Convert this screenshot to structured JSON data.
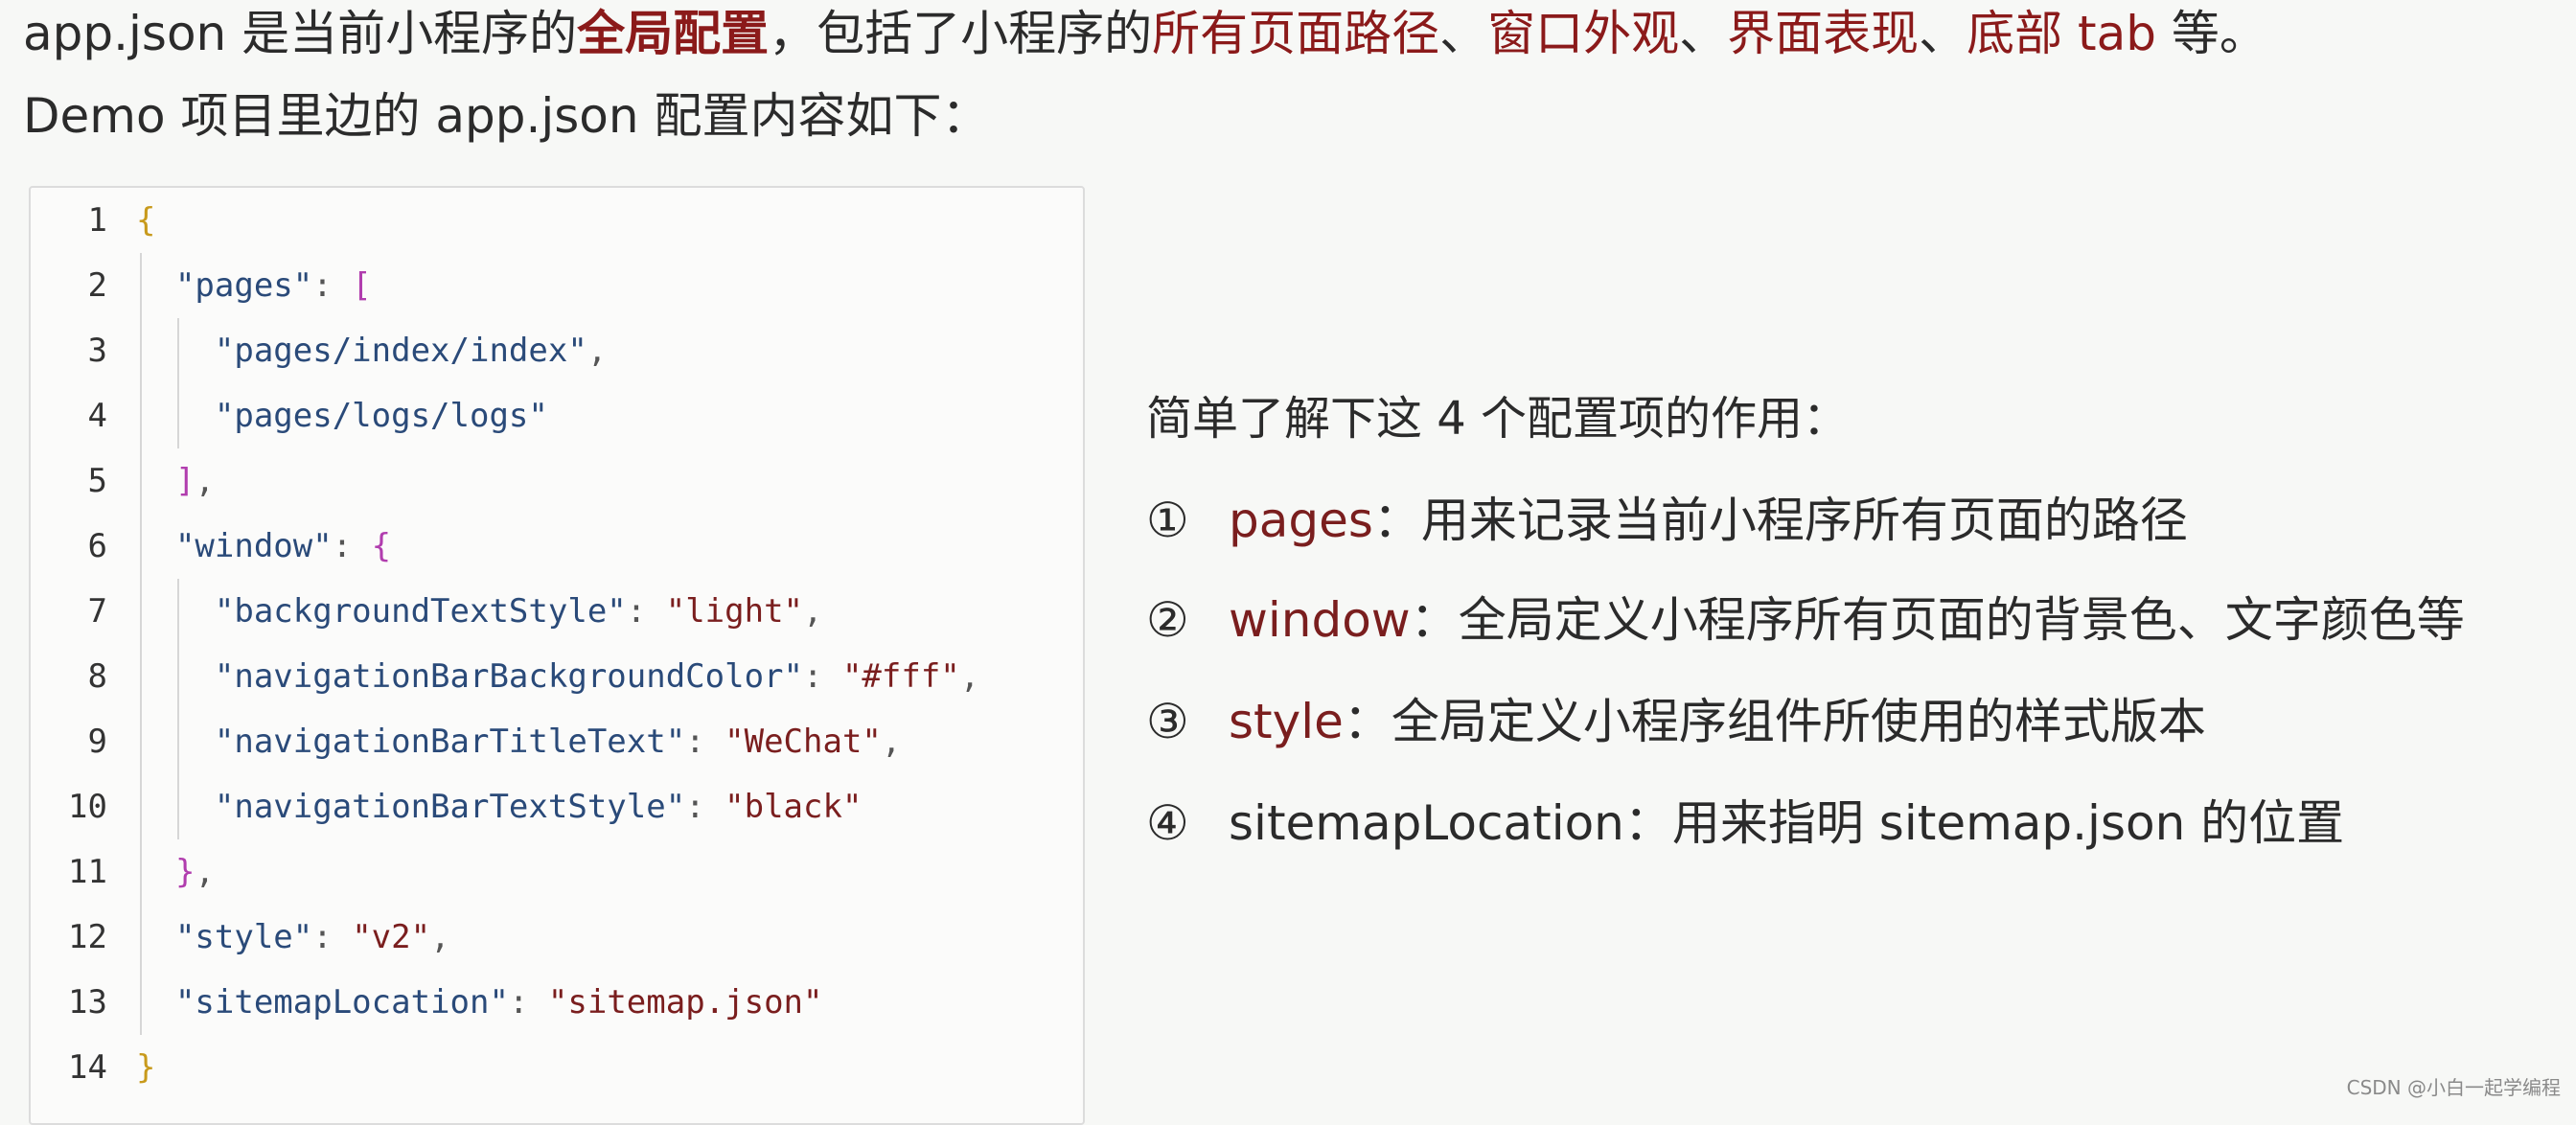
{
  "intro": {
    "line1": {
      "part1": "app.json 是当前小程序的",
      "highlight": "全局配置",
      "part2": "，包括了小程序的",
      "r1": "所有页面路径",
      "sep1": "、",
      "r2": "窗口外观",
      "sep2": "、",
      "r3": "界面表现",
      "sep3": "、",
      "r4": "底部 tab",
      "part3": " 等。"
    },
    "line2": "Demo 项目里边的 app.json 配置内容如下："
  },
  "code": {
    "line_numbers": [
      "1",
      "2",
      "3",
      "4",
      "5",
      "6",
      "7",
      "8",
      "9",
      "10",
      "11",
      "12",
      "13",
      "14"
    ],
    "l1_open": "{",
    "l2_key": "\"pages\"",
    "l2_colon": ": ",
    "l2_bracket": "[",
    "l3_str": "\"pages/index/index\"",
    "l3_comma": ",",
    "l4_str": "\"pages/logs/logs\"",
    "l5_bracket": "]",
    "l5_comma": ",",
    "l6_key": "\"window\"",
    "l6_colon": ": ",
    "l6_brace": "{",
    "l7_key": "\"backgroundTextStyle\"",
    "l7_colon": ": ",
    "l7_val": "\"light\"",
    "l7_comma": ",",
    "l8_key": "\"navigationBarBackgroundColor\"",
    "l8_colon": ": ",
    "l8_val": "\"#fff\"",
    "l8_comma": ",",
    "l9_key": "\"navigationBarTitleText\"",
    "l9_colon": ": ",
    "l9_val": "\"WeChat\"",
    "l9_comma": ",",
    "l10_key": "\"navigationBarTextStyle\"",
    "l10_colon": ": ",
    "l10_val": "\"black\"",
    "l11_brace": "}",
    "l11_comma": ",",
    "l12_key": "\"style\"",
    "l12_colon": ": ",
    "l12_val": "\"v2\"",
    "l12_comma": ",",
    "l13_key": "\"sitemapLocation\"",
    "l13_colon": ": ",
    "l13_val": "\"sitemap.json\"",
    "l14_close": "}"
  },
  "explain": {
    "heading": "简单了解下这 4 个配置项的作用：",
    "items": [
      {
        "num": "①",
        "key": "pages",
        "desc": "：用来记录当前小程序所有页面的路径"
      },
      {
        "num": "②",
        "key": "window",
        "desc": "：全局定义小程序所有页面的背景色、文字颜色等"
      },
      {
        "num": "③",
        "key": "style",
        "desc": "：全局定义小程序组件所使用的样式版本"
      },
      {
        "num": "④",
        "key": "sitemapLocation",
        "desc": "：用来指明 sitemap.json 的位置"
      }
    ]
  },
  "watermark": "CSDN @小白一起学编程",
  "colors": {
    "highlight_red": "#8b1a1a",
    "json_key": "#2a4a79",
    "json_string": "#7a1e1e",
    "brace": "#c89a1c",
    "bracket": "#b13dae"
  }
}
